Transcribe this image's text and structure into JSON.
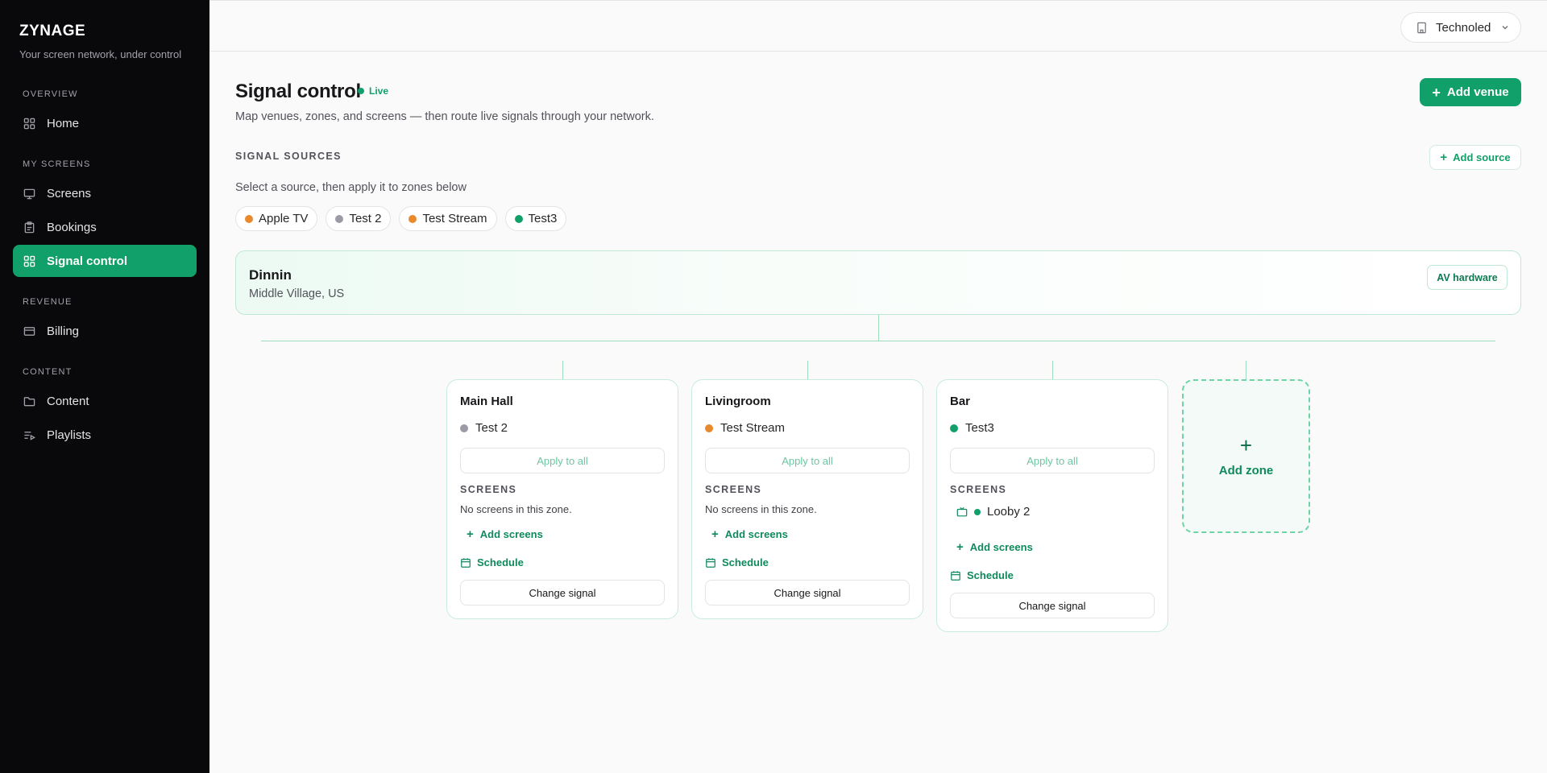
{
  "app": {
    "brand": "ZYNAGE",
    "tagline": "Your screen network, under control"
  },
  "sidebar": {
    "sections": [
      {
        "label": "OVERVIEW"
      },
      {
        "label": "MY SCREENS"
      },
      {
        "label": "REVENUE"
      },
      {
        "label": "CONTENT"
      }
    ],
    "items": [
      {
        "label": "Home",
        "icon": "grid-icon"
      },
      {
        "label": "Screens",
        "icon": "monitor-icon"
      },
      {
        "label": "Bookings",
        "icon": "clipboard-icon"
      },
      {
        "label": "Signal control",
        "icon": "grid-icon",
        "active": true
      },
      {
        "label": "Billing",
        "icon": "credit-card-icon"
      },
      {
        "label": "Content",
        "icon": "folder-icon"
      },
      {
        "label": "Playlists",
        "icon": "playlist-icon"
      }
    ]
  },
  "topbar": {
    "org": "Technoled"
  },
  "header": {
    "title": "Signal control",
    "status": "Live",
    "subtitle": "Map venues, zones, and screens — then route live signals through your network.",
    "add_venue": "Add venue"
  },
  "sources": {
    "label": "SIGNAL SOURCES",
    "add_label": "Add source",
    "hint": "Select a source, then apply it to zones below",
    "chips": [
      {
        "label": "Apple TV",
        "color": "#e8892b"
      },
      {
        "label": "Test 2",
        "color": "#9b9ba5"
      },
      {
        "label": "Test Stream",
        "color": "#e8892b"
      },
      {
        "label": "Test3",
        "color": "#12a06a"
      }
    ]
  },
  "venue": {
    "name": "Dinnin",
    "location": "Middle Village, US",
    "av_label": "AV hardware"
  },
  "zones": [
    {
      "name": "Main Hall",
      "signal": "Test 2",
      "signal_color": "#9b9ba5",
      "apply": "Apply to all",
      "screens_label": "SCREENS",
      "empty": "No screens in this zone.",
      "add_screens": "Add screens",
      "schedule": "Schedule",
      "change": "Change signal"
    },
    {
      "name": "Livingroom",
      "signal": "Test Stream",
      "signal_color": "#e8892b",
      "apply": "Apply to all",
      "screens_label": "SCREENS",
      "empty": "No screens in this zone.",
      "add_screens": "Add screens",
      "schedule": "Schedule",
      "change": "Change signal"
    },
    {
      "name": "Bar",
      "signal": "Test3",
      "signal_color": "#12a06a",
      "apply": "Apply to all",
      "screens_label": "SCREENS",
      "screens": [
        {
          "name": "Looby 2"
        }
      ],
      "add_screens": "Add screens",
      "schedule": "Schedule",
      "change": "Change signal"
    }
  ],
  "add_zone": "Add zone"
}
